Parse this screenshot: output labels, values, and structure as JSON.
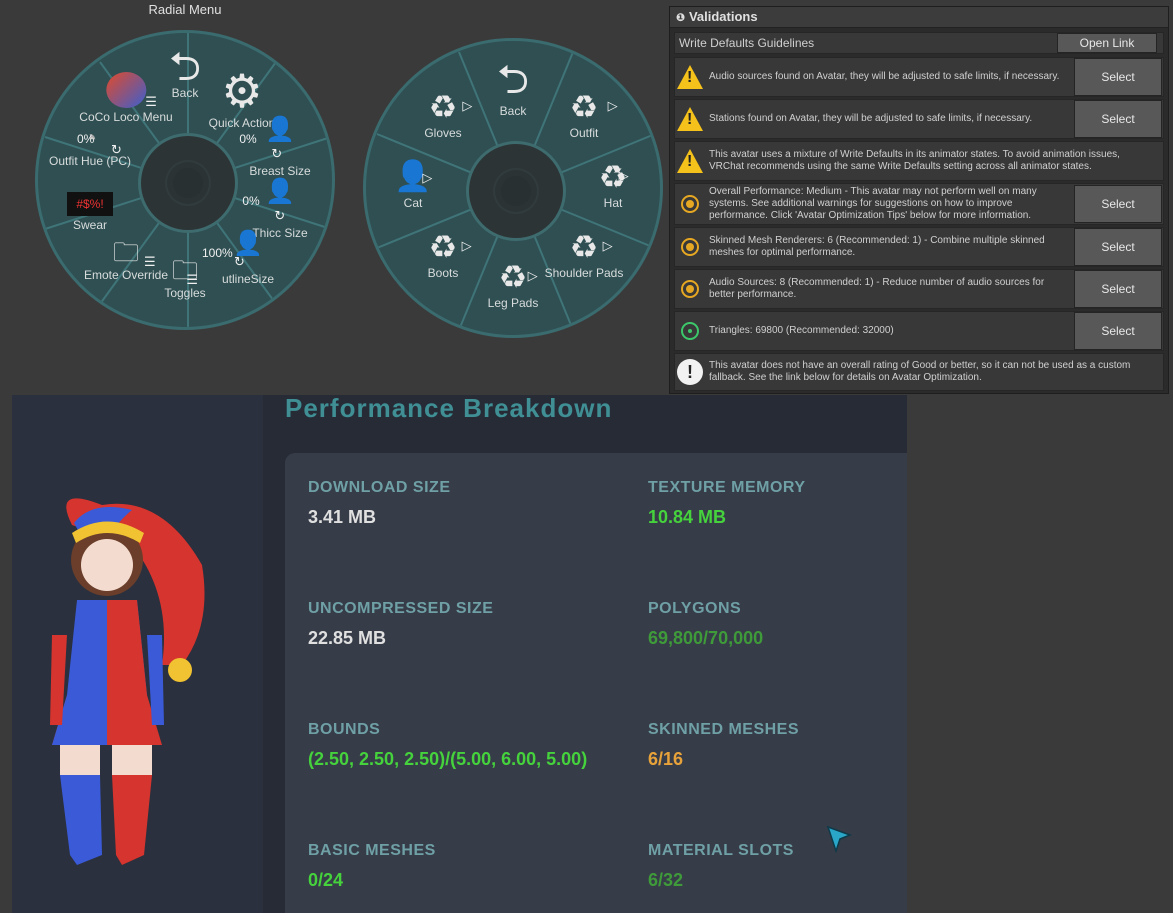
{
  "radial_menu_1": {
    "title": "Radial Menu",
    "items": [
      {
        "label": "Back",
        "icon": "back-arrow-icon"
      },
      {
        "label": "Quick Action",
        "icon": "gear-icon"
      },
      {
        "label": "Breast Size",
        "icon": "person-icon",
        "value": "0%"
      },
      {
        "label": "Thicc Size",
        "icon": "person-icon",
        "value": "0%"
      },
      {
        "label": "utlineSize",
        "icon": "person-icon",
        "value": "100%"
      },
      {
        "label": "Toggles",
        "icon": "folder-icon"
      },
      {
        "label": "Emote Override",
        "icon": "folder-icon"
      },
      {
        "label": "Swear",
        "icon": "swear-icon"
      },
      {
        "label": "Outfit Hue (PC)",
        "icon": "hue-icon",
        "value": "0%"
      },
      {
        "label": "CoCo Loco Menu",
        "icon": "coco-logo-icon"
      }
    ]
  },
  "radial_menu_2": {
    "items": [
      {
        "label": "Back",
        "icon": "back-arrow-icon"
      },
      {
        "label": "Outfit",
        "icon": "outfit-icon"
      },
      {
        "label": "Hat",
        "icon": "outfit-icon"
      },
      {
        "label": "Shoulder Pads",
        "icon": "outfit-icon"
      },
      {
        "label": "Leg Pads",
        "icon": "outfit-icon"
      },
      {
        "label": "Boots",
        "icon": "outfit-icon"
      },
      {
        "label": "Cat",
        "icon": "person-icon"
      },
      {
        "label": "Gloves",
        "icon": "outfit-icon"
      }
    ]
  },
  "validations": {
    "title": "Validations",
    "guideline": {
      "label": "Write Defaults Guidelines",
      "button": "Open Link"
    },
    "rows": [
      {
        "type": "warning",
        "text": "Audio sources found on Avatar, they will be adjusted to safe limits, if necessary.",
        "button": "Select"
      },
      {
        "type": "warning",
        "text": "Stations found on Avatar, they will be adjusted to safe limits, if necessary.",
        "button": "Select"
      },
      {
        "type": "warning",
        "text": "This avatar uses a mixture of Write Defaults in its animator states. To avoid animation issues, VRChat recommends using the same Write Defaults setting across all animator states.",
        "button": ""
      },
      {
        "type": "medium",
        "text": "Overall Performance: Medium - This avatar may not perform well on many systems. See additional warnings for suggestions on how to improve performance. Click 'Avatar Optimization Tips' below for more information.",
        "button": "Select"
      },
      {
        "type": "medium",
        "text": "Skinned Mesh Renderers: 6 (Recommended: 1) - Combine multiple skinned meshes for optimal performance.",
        "button": "Select"
      },
      {
        "type": "medium",
        "text": "Audio Sources: 8 (Recommended: 1) - Reduce number of audio sources for better performance.",
        "button": "Select"
      },
      {
        "type": "good",
        "text": "Triangles: 69800 (Recommended: 32000)",
        "button": "Select"
      },
      {
        "type": "info",
        "text": "This avatar does not have an overall rating of Good or better, so it can not be used as a custom fallback. See the link below for details on Avatar Optimization.",
        "button": ""
      }
    ]
  },
  "performance": {
    "title": "Performance Breakdown",
    "stats": [
      {
        "label": "DOWNLOAD SIZE",
        "value": "3.41 MB",
        "color": "#e0e0e0"
      },
      {
        "label": "TEXTURE MEMORY",
        "value": "10.84 MB",
        "color": "#45d23c"
      },
      {
        "label": "UNCOMPRESSED SIZE",
        "value": "22.85 MB",
        "color": "#e0e0e0"
      },
      {
        "label": "POLYGONS",
        "value": "69,800/70,000",
        "color": "#3f9a3a"
      },
      {
        "label": "BOUNDS",
        "value": "(2.50, 2.50, 2.50)/(5.00, 6.00, 5.00)",
        "color": "#45d23c"
      },
      {
        "label": "SKINNED MESHES",
        "value": "6/16",
        "color": "#e8a23a"
      },
      {
        "label": "BASIC MESHES",
        "value": "0/24",
        "color": "#45d23c"
      },
      {
        "label": "MATERIAL SLOTS",
        "value": "6/32",
        "color": "#3f9a3a"
      }
    ]
  }
}
